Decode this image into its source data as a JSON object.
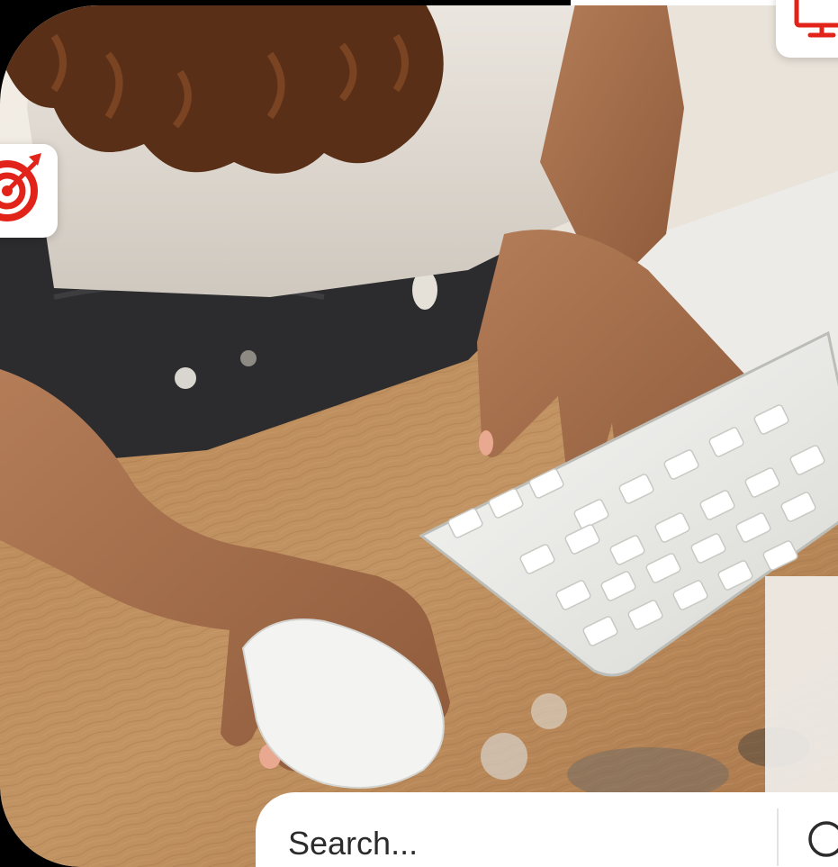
{
  "search": {
    "placeholder": "Search..."
  },
  "icons": {
    "target": "target-arrow-icon",
    "monitor": "monitor-icon",
    "search": "search-icon"
  },
  "colors": {
    "accent": "#e2231a",
    "badge_bg": "#ffffff",
    "search_text": "#2b2b2b"
  }
}
